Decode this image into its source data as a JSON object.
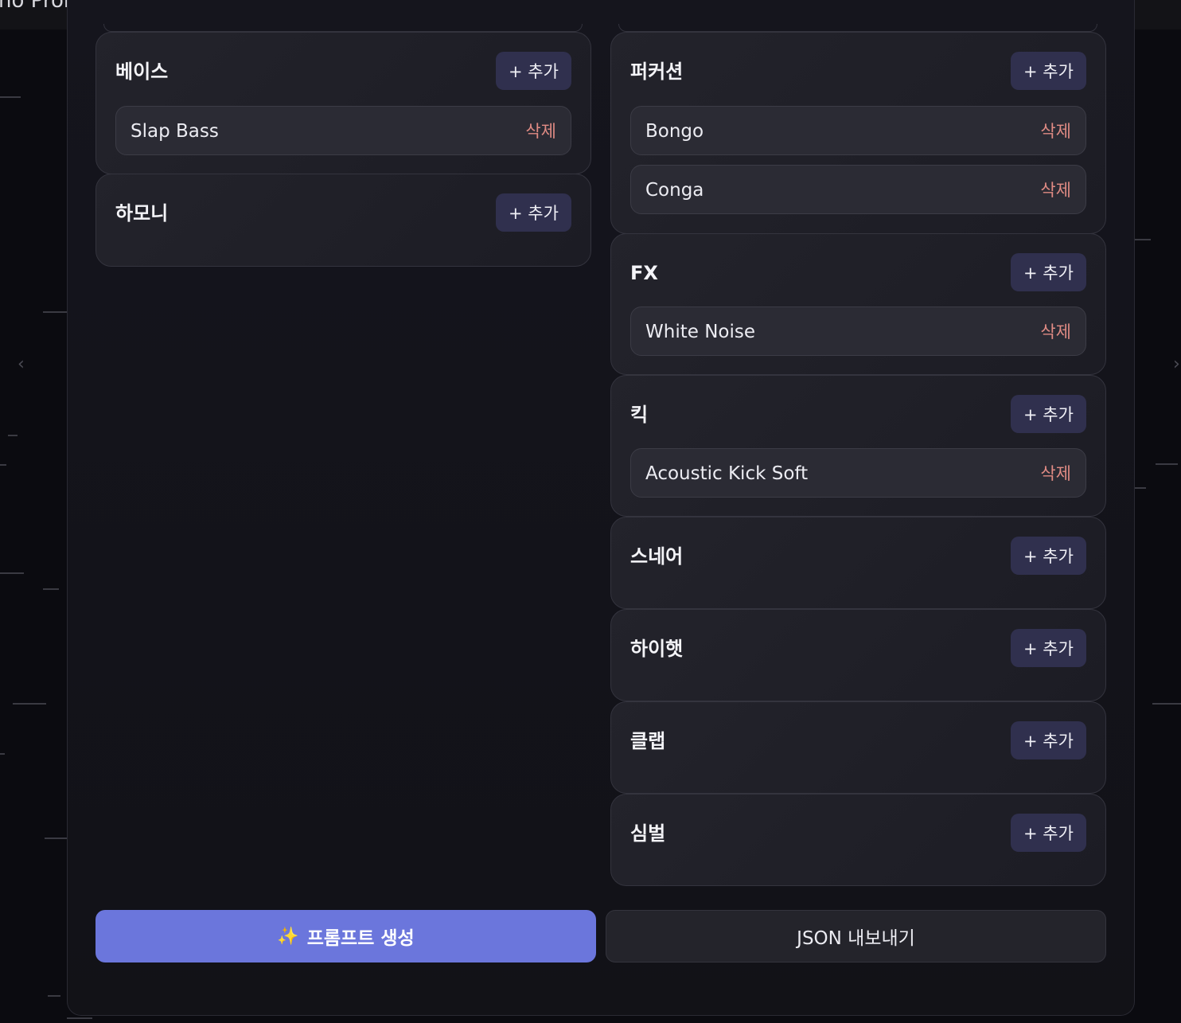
{
  "window": {
    "title": "no Prompt Studio - FOs pol...",
    "caret": "⌄"
  },
  "nav": {
    "prev": "‹",
    "next": "›"
  },
  "add_label": "+ 추가",
  "delete_label": "삭제",
  "left_sections": [
    {
      "name": "베이스",
      "items": [
        "Slap Bass"
      ]
    },
    {
      "name": "하모니",
      "items": []
    }
  ],
  "right_sections": [
    {
      "name": "퍼커션",
      "items": [
        "Bongo",
        "Conga"
      ]
    },
    {
      "name": "FX",
      "items": [
        "White Noise"
      ]
    },
    {
      "name": "킥",
      "items": [
        "Acoustic Kick Soft"
      ]
    },
    {
      "name": "스네어",
      "items": []
    },
    {
      "name": "하이햇",
      "items": []
    },
    {
      "name": "클랩",
      "items": []
    },
    {
      "name": "심벌",
      "items": []
    }
  ],
  "actions": {
    "generate_icon": "✨",
    "generate_label": "프롬프트 생성",
    "export_label": "JSON 내보내기"
  }
}
